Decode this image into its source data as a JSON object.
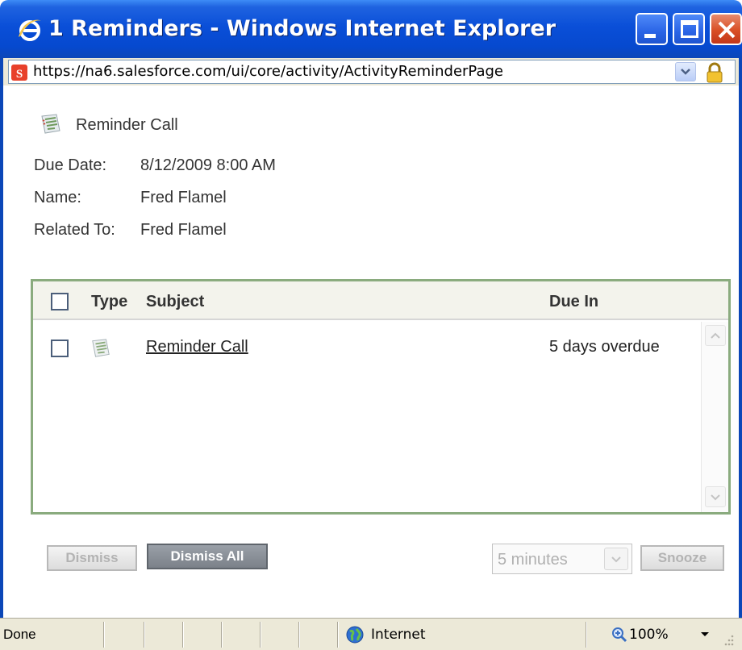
{
  "window": {
    "title": "1 Reminders - Windows Internet Explorer",
    "app_icon": "ie-icon",
    "accent": "#0b47b8"
  },
  "addressbar": {
    "url": "https://na6.salesforce.com/ui/core/activity/ActivityReminderPage",
    "site_icon": "salesforce-favicon",
    "lock_icon": "padlock-icon"
  },
  "reminder": {
    "title": "Reminder Call",
    "icon": "task-icon",
    "fields": [
      {
        "label": "Due Date:",
        "value": "8/12/2009 8:00 AM"
      },
      {
        "label": "Name:",
        "value": "Fred Flamel"
      },
      {
        "label": "Related To:",
        "value": "Fred Flamel"
      }
    ]
  },
  "list": {
    "headers": {
      "type": "Type",
      "subject": "Subject",
      "due": "Due In"
    },
    "rows": [
      {
        "subject": "Reminder Call",
        "due": "5 days overdue",
        "icon": "task-icon"
      }
    ],
    "border_color": "#8aab7e"
  },
  "actions": {
    "dismiss_label": "Dismiss",
    "dismiss_all_label": "Dismiss All",
    "snooze_select_value": "5 minutes",
    "snooze_label": "Snooze"
  },
  "statusbar": {
    "status": "Done",
    "zone": "Internet",
    "zoom": "100%"
  }
}
